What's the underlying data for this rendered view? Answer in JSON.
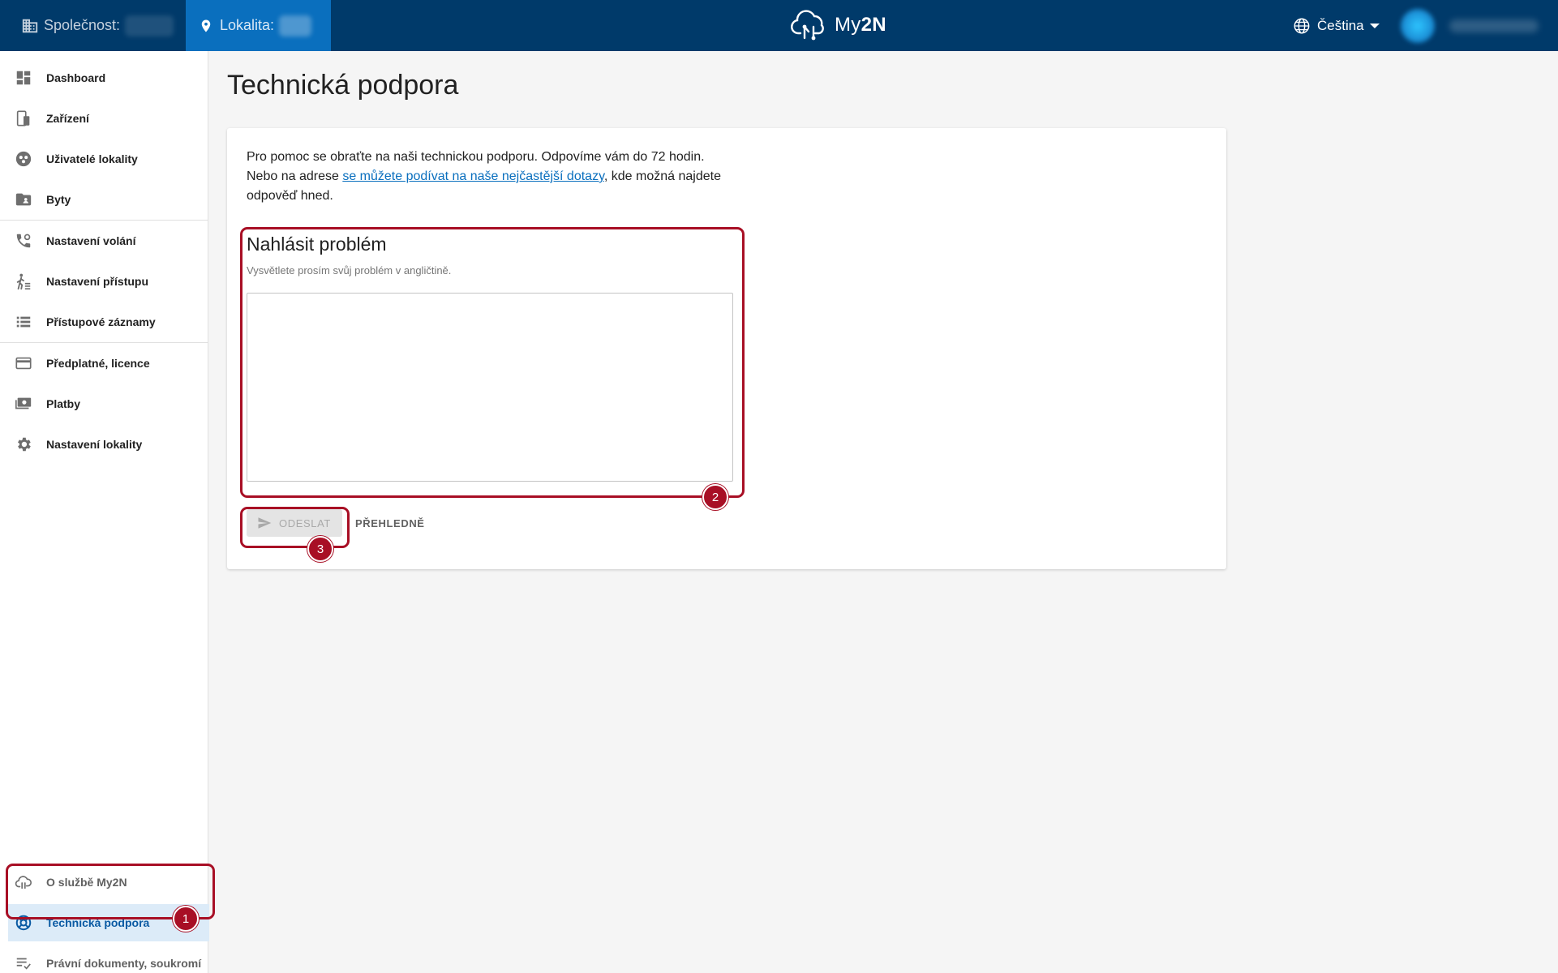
{
  "topbar": {
    "company_label": "Společnost:",
    "site_label": "Lokalita:",
    "logo_text_light": "My",
    "logo_text_bold": "2N",
    "language": "Čeština"
  },
  "sidebar": {
    "items": [
      {
        "label": "Dashboard",
        "icon": "dashboard-icon"
      },
      {
        "label": "Zařízení",
        "icon": "device-icon"
      },
      {
        "label": "Uživatelé lokality",
        "icon": "users-icon"
      },
      {
        "label": "Byty",
        "icon": "apartment-icon"
      },
      {
        "label": "Nastavení volání",
        "icon": "call-settings-icon"
      },
      {
        "label": "Nastavení přístupu",
        "icon": "access-settings-icon"
      },
      {
        "label": "Přístupové záznamy",
        "icon": "access-log-icon"
      },
      {
        "label": "Předplatné, licence",
        "icon": "credit-card-icon"
      },
      {
        "label": "Platby",
        "icon": "payments-icon"
      },
      {
        "label": "Nastavení lokality",
        "icon": "gear-icon"
      }
    ],
    "bottom_items": [
      {
        "label": "O službě My2N",
        "icon": "cloud-icon"
      },
      {
        "label": "Technická podpora",
        "icon": "support-icon"
      },
      {
        "label": "Právní dokumenty, soukromí",
        "icon": "legal-docs-icon"
      }
    ]
  },
  "main": {
    "title": "Technická podpora",
    "intro_line1": "Pro pomoc se obraťte na naši technickou podporu. Odpovíme vám do 72 hodin.",
    "intro_prefix": "Nebo na adrese ",
    "intro_link": "se můžete podívat na naše nejčastější dotazy",
    "intro_suffix": ", kde možná najdete odpověď hned.",
    "form_title": "Nahlásit problém",
    "form_help": "Vysvětlete prosím svůj problém v angličtině.",
    "textarea_value": "",
    "send_label": "ODESLAT",
    "clear_label": "PŘEHLEDNĚ"
  },
  "annotations": {
    "badge1": "1",
    "badge2": "2",
    "badge3": "3",
    "color": "#a80f25"
  },
  "colors": {
    "topbar": "#003a6a",
    "site_tab": "#0a6fbe",
    "active_nav_bg": "#dcebf8",
    "active_nav_text": "#0a5aa3"
  }
}
